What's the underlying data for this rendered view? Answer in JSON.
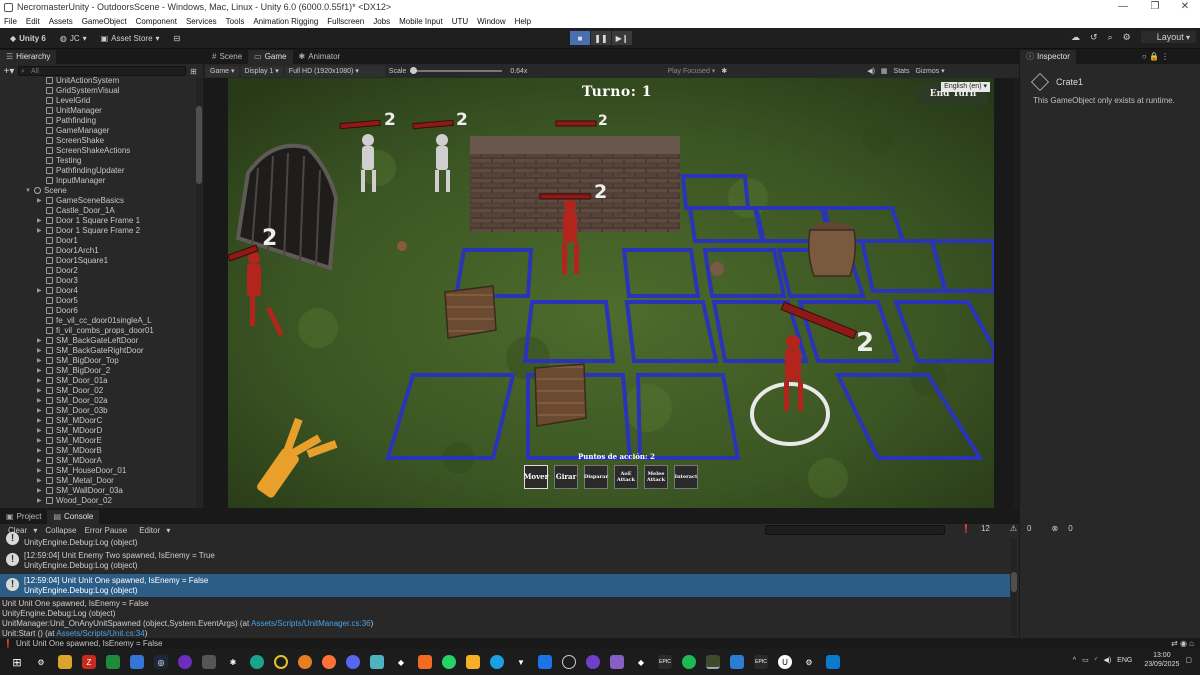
{
  "window": {
    "title": "NecromasterUnity - OutdoorsScene - Windows, Mac, Linux - Unity 6.0 (6000.0.55f1)* <DX12>",
    "controls": [
      "—",
      "❐",
      "✕"
    ]
  },
  "menu": [
    "File",
    "Edit",
    "Assets",
    "GameObject",
    "Component",
    "Services",
    "Tools",
    "Animation Rigging",
    "Fullscreen",
    "Jobs",
    "Mobile Input",
    "UTU",
    "Window",
    "Help"
  ],
  "toolbar": {
    "unity_label": "Unity 6",
    "account": "JC",
    "asset_store": "Asset Store",
    "layout": "Layout"
  },
  "hierarchy": {
    "tab": "Hierarchy",
    "search_placeholder": "All",
    "items": [
      {
        "label": "UnitActionSystem",
        "indent": 3,
        "arrow": false
      },
      {
        "label": "GridSystemVisual",
        "indent": 3,
        "arrow": false
      },
      {
        "label": "LevelGrid",
        "indent": 3,
        "arrow": false
      },
      {
        "label": "UnitManager",
        "indent": 3,
        "arrow": false
      },
      {
        "label": "Pathfinding",
        "indent": 3,
        "arrow": false
      },
      {
        "label": "GameManager",
        "indent": 3,
        "arrow": false
      },
      {
        "label": "ScreenShake",
        "indent": 3,
        "arrow": false
      },
      {
        "label": "ScreenShakeActions",
        "indent": 3,
        "arrow": false
      },
      {
        "label": "Testing",
        "indent": 3,
        "arrow": false
      },
      {
        "label": "PathfindingUpdater",
        "indent": 3,
        "arrow": false
      },
      {
        "label": "InputManager",
        "indent": 3,
        "arrow": false
      },
      {
        "label": "Scene",
        "indent": 2,
        "arrow": true,
        "open": true
      },
      {
        "label": "GameSceneBasics",
        "indent": 3,
        "arrow": true
      },
      {
        "label": "Castle_Door_1A",
        "indent": 3,
        "arrow": false
      },
      {
        "label": "Door 1 Square Frame 1",
        "indent": 3,
        "arrow": true
      },
      {
        "label": "Door 1 Square Frame 2",
        "indent": 3,
        "arrow": true
      },
      {
        "label": "Door1",
        "indent": 3,
        "arrow": false
      },
      {
        "label": "Door1Arch1",
        "indent": 3,
        "arrow": false
      },
      {
        "label": "Door1Square1",
        "indent": 3,
        "arrow": false
      },
      {
        "label": "Door2",
        "indent": 3,
        "arrow": false
      },
      {
        "label": "Door3",
        "indent": 3,
        "arrow": false
      },
      {
        "label": "Door4",
        "indent": 3,
        "arrow": true
      },
      {
        "label": "Door5",
        "indent": 3,
        "arrow": false
      },
      {
        "label": "Door6",
        "indent": 3,
        "arrow": false
      },
      {
        "label": "fe_vil_cc_door01singleA_L",
        "indent": 3,
        "arrow": false
      },
      {
        "label": "fi_vil_combs_props_door01",
        "indent": 3,
        "arrow": false
      },
      {
        "label": "SM_BackGateLeftDoor",
        "indent": 3,
        "arrow": true
      },
      {
        "label": "SM_BackGateRightDoor",
        "indent": 3,
        "arrow": true
      },
      {
        "label": "SM_BigDoor_Top",
        "indent": 3,
        "arrow": true
      },
      {
        "label": "SM_BigDoor_2",
        "indent": 3,
        "arrow": true
      },
      {
        "label": "SM_Door_01a",
        "indent": 3,
        "arrow": true
      },
      {
        "label": "SM_Door_02",
        "indent": 3,
        "arrow": true
      },
      {
        "label": "SM_Door_02a",
        "indent": 3,
        "arrow": true
      },
      {
        "label": "SM_Door_03b",
        "indent": 3,
        "arrow": true
      },
      {
        "label": "SM_MDoorC",
        "indent": 3,
        "arrow": true
      },
      {
        "label": "SM_MDoorD",
        "indent": 3,
        "arrow": true
      },
      {
        "label": "SM_MDoorE",
        "indent": 3,
        "arrow": true
      },
      {
        "label": "SM_MDoorB",
        "indent": 3,
        "arrow": true
      },
      {
        "label": "SM_MDoorA",
        "indent": 3,
        "arrow": true
      },
      {
        "label": "SM_HouseDoor_01",
        "indent": 3,
        "arrow": true
      },
      {
        "label": "SM_Metal_Door",
        "indent": 3,
        "arrow": true
      },
      {
        "label": "SM_WallDoor_03a",
        "indent": 3,
        "arrow": true
      },
      {
        "label": "Wood_Door_02",
        "indent": 3,
        "arrow": true
      }
    ]
  },
  "game": {
    "tabs": [
      {
        "label": "Scene",
        "active": false
      },
      {
        "label": "Game",
        "active": true
      },
      {
        "label": "Animator",
        "active": false
      }
    ],
    "bar": {
      "mode": "Game",
      "display": "Display 1",
      "resolution": "Full HD (1920x1080)",
      "scale_label": "Scale",
      "scale_value": "0.64x",
      "play_focused": "Play Focused",
      "stats": "Stats",
      "gizmos": "Gizmos"
    },
    "language": "English (en)",
    "turn_label": "Turno: 1",
    "end_turn": "End Turn",
    "action_points": "Puntos de acción: 2",
    "actions": [
      "Mover",
      "Girar",
      "Disparar",
      "AoE Attack",
      "Melee Attack",
      "Interact"
    ],
    "health_numbers": [
      "2",
      "2",
      "2",
      "2",
      "2",
      "2"
    ]
  },
  "inspector": {
    "tab": "Inspector",
    "object": "Crate1",
    "note": "This GameObject only exists at runtime."
  },
  "console": {
    "tabs": [
      {
        "label": "Project",
        "active": false
      },
      {
        "label": "Console",
        "active": true
      }
    ],
    "bar": [
      "Clear",
      "Collapse",
      "Error Pause",
      "Editor"
    ],
    "count": "12",
    "warn_count": "0",
    "err_count": "0",
    "rows": [
      {
        "line1": "UnityEngine.Debug:Log (object)",
        "line2": "",
        "selected": false
      },
      {
        "line1": "[12:59:04] Unit Enemy Two spawned, IsEnemy = True",
        "line2": "UnityEngine.Debug:Log (object)",
        "selected": false
      },
      {
        "line1": "[12:59:04] Unit Unit One spawned, IsEnemy = False",
        "line2": "UnityEngine.Debug:Log (object)",
        "selected": true
      }
    ],
    "detail": [
      "Unit Unit One spawned, IsEnemy = False",
      "UnityEngine.Debug:Log (object)",
      "UnitManager:Unit_OnAnyUnitSpawned (object,System.EventArgs) (at ",
      "Unit:Start () (at "
    ],
    "detail_links": [
      "Assets/Scripts/UnitManager.cs:36",
      "Assets/Scripts/Unit.cs:34"
    ],
    "detail_suffix": [
      ")",
      ")"
    ]
  },
  "status": "Unit Unit One spawned, IsEnemy = False",
  "taskbar": {
    "lang": "ENG",
    "time": "13:00",
    "date": "23/09/2025"
  }
}
